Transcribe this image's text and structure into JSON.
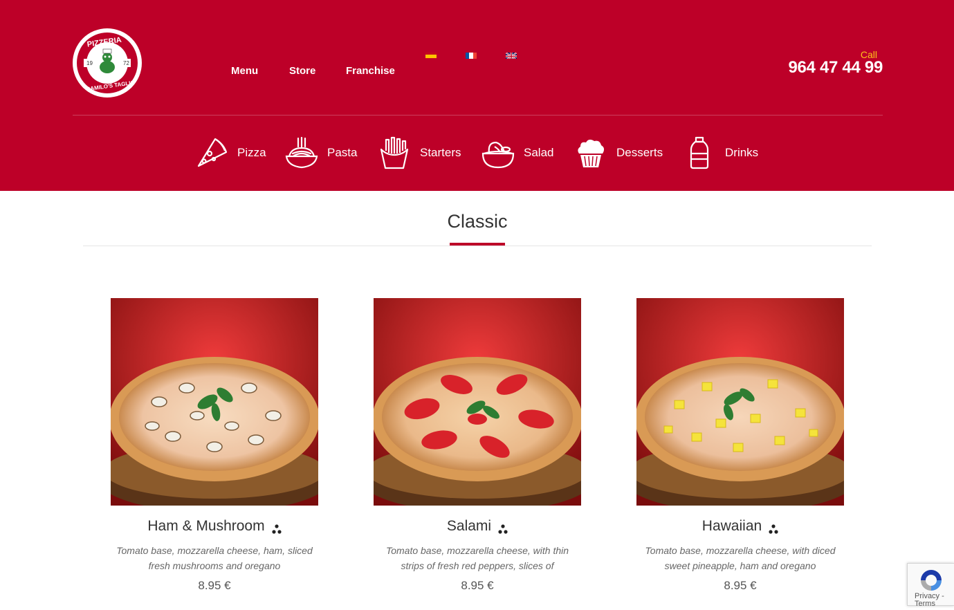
{
  "header": {
    "logo_alt": "Pizzeria Camilo's Taglio 1972",
    "logo_text": {
      "top": "PIZZERIA",
      "bottom": "CAMILO'S TAGLIO",
      "left": "19",
      "right": "72"
    },
    "nav": [
      "Menu",
      "Store",
      "Franchise"
    ],
    "languages": [
      "es-flag",
      "fr-flag",
      "uk-flag"
    ],
    "call_label": "Call",
    "phone": "964 47 44 99",
    "colors": {
      "brand_red": "#bd0028",
      "accent_yellow": "#ffc21a"
    }
  },
  "categories": [
    {
      "label": "Pizza",
      "icon": "pizza-slice-icon"
    },
    {
      "label": "Pasta",
      "icon": "pasta-bowl-icon"
    },
    {
      "label": "Starters",
      "icon": "fries-icon"
    },
    {
      "label": "Salad",
      "icon": "salad-bowl-icon"
    },
    {
      "label": "Desserts",
      "icon": "cupcake-icon"
    },
    {
      "label": "Drinks",
      "icon": "bottle-icon"
    }
  ],
  "section": {
    "title": "Classic"
  },
  "products": [
    {
      "name": "Ham & Mushroom",
      "description": "Tomato base, mozzarella cheese, ham, sliced fresh mushrooms and oregano",
      "price": "8.95 €",
      "topping": "mushroom"
    },
    {
      "name": "Salami",
      "description": "Tomato base, mozzarella cheese, with thin strips of fresh red peppers, slices of",
      "price": "8.95 €",
      "topping": "salami"
    },
    {
      "name": "Hawaiian",
      "description": "Tomato base, mozzarella cheese, with diced sweet pineapple, ham and oregano",
      "price": "8.95 €",
      "topping": "pineapple"
    }
  ],
  "recaptcha": {
    "text": "Privacy - Terms"
  }
}
